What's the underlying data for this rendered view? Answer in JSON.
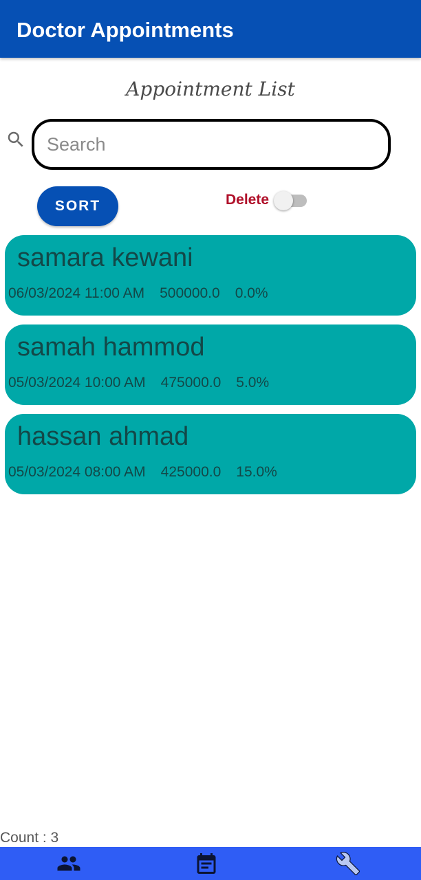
{
  "appbar": {
    "title": "Doctor Appointments"
  },
  "list_title": "Appointment List",
  "search": {
    "placeholder": "Search",
    "value": ""
  },
  "controls": {
    "sort_label": "SORT",
    "delete_label": "Delete",
    "delete_toggle_on": false
  },
  "appointments": [
    {
      "name": "samara kewani",
      "datetime": "06/03/2024 11:00 AM",
      "amount": "500000.0",
      "discount": "0.0%"
    },
    {
      "name": "samah hammod",
      "datetime": "05/03/2024 10:00 AM",
      "amount": "475000.0",
      "discount": "5.0%"
    },
    {
      "name": "hassan ahmad",
      "datetime": "05/03/2024 08:00 AM",
      "amount": "425000.0",
      "discount": "15.0%"
    }
  ],
  "count_label": "Count : 3",
  "bottom_nav": [
    {
      "icon": "people-icon"
    },
    {
      "icon": "calendar-icon"
    },
    {
      "icon": "wrench-icon"
    }
  ],
  "colors": {
    "appbar": "#0650b4",
    "card": "#00a8a8",
    "card_text": "#134848",
    "delete_label": "#b0102a",
    "bottom_nav": "#2f5df5"
  }
}
